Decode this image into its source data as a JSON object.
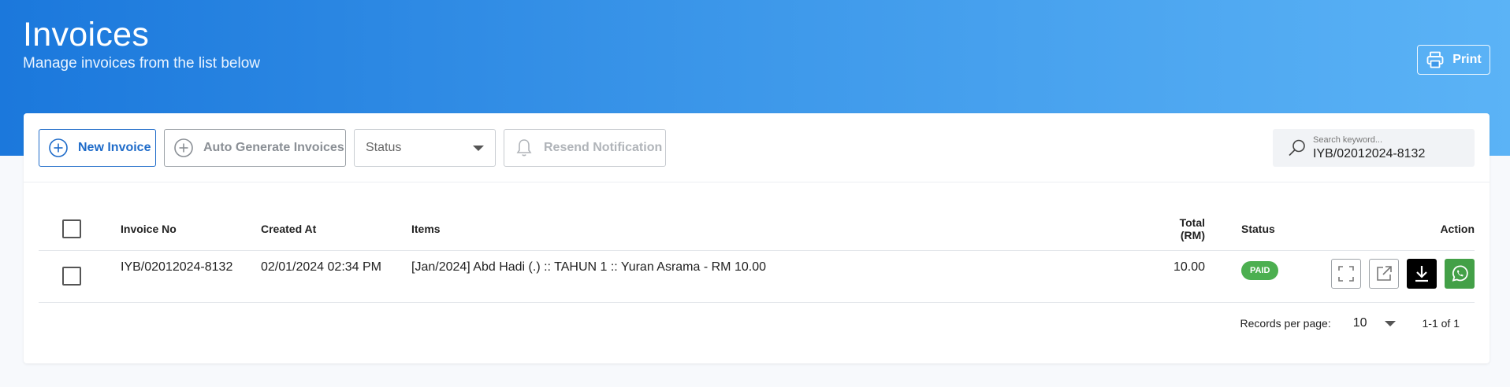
{
  "header": {
    "title": "Invoices",
    "subtitle": "Manage invoices from the list below",
    "print_label": "Print"
  },
  "toolbar": {
    "new_invoice_label": "New Invoice",
    "auto_generate_label": "Auto Generate Invoices",
    "status_select_value": "Status",
    "resend_label": "Resend Notification",
    "search_label": "Search keyword...",
    "search_value": "IYB/02012024-8132"
  },
  "table": {
    "columns": [
      "Invoice No",
      "Created At",
      "Items",
      "Total (RM)",
      "Status",
      "Action"
    ],
    "rows": [
      {
        "invoice_no": "IYB/02012024-8132",
        "created_at": "02/01/2024 02:34 PM",
        "items": "[Jan/2024] Abd Hadi (.) :: TAHUN 1 :: Yuran Asrama - RM 10.00",
        "total": "10.00",
        "status": "PAID",
        "actions": [
          "expand-icon",
          "external-link-icon",
          "download-icon",
          "whatsapp-icon"
        ]
      }
    ]
  },
  "pagination": {
    "records_per_page_label": "Records per page:",
    "records_per_page_value": "10",
    "range": "1-1 of 1"
  },
  "colors": {
    "accent": "#1e6bc9",
    "banner_start": "#1b78dc",
    "banner_end": "#5bb3f6",
    "paid": "#4caf50",
    "whatsapp": "#43a047"
  }
}
